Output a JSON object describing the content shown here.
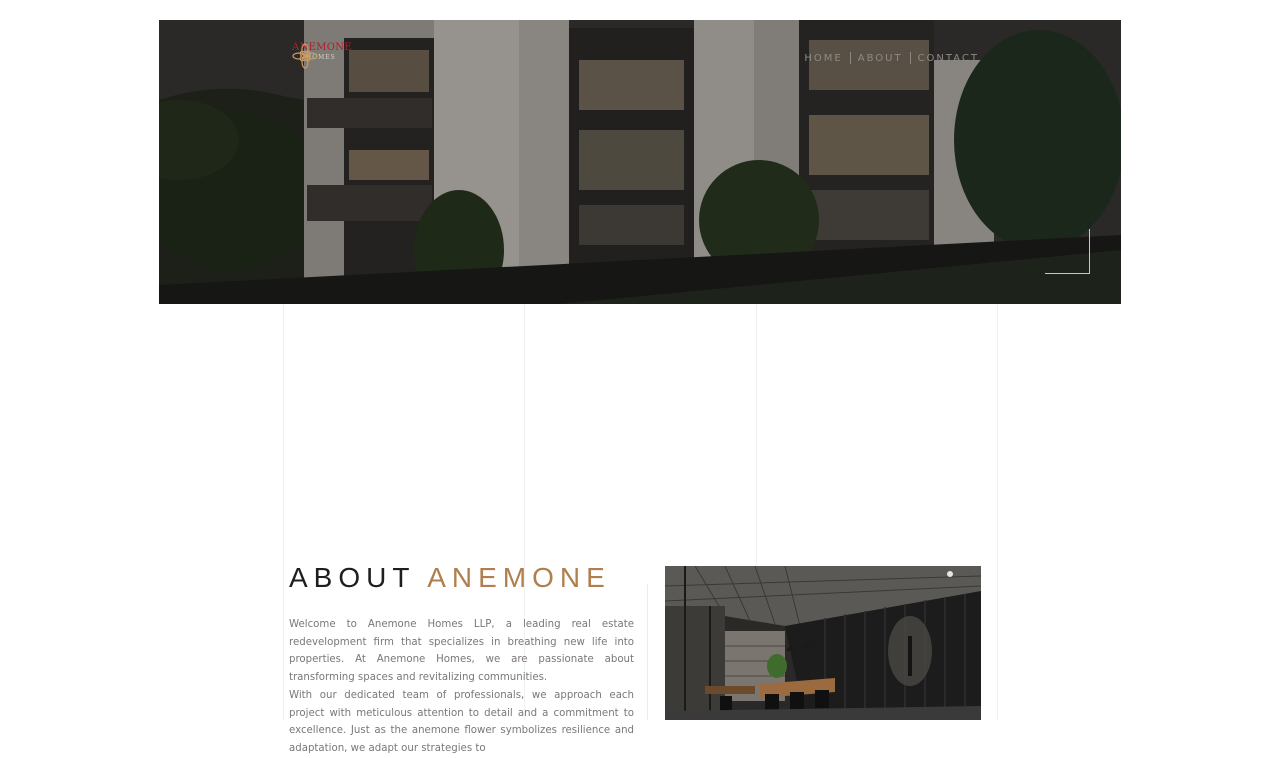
{
  "brand": {
    "name": "ANEMONE",
    "subtitle": "HOMES",
    "logo_icon": "anemone-flower-icon",
    "accent_color": "#b07f4e",
    "logo_color": "#b01f2a"
  },
  "nav": {
    "items": [
      {
        "label": "HOME"
      },
      {
        "label": "ABOUT"
      },
      {
        "label": "CONTACT"
      }
    ]
  },
  "about": {
    "title_plain": "ABOUT",
    "title_accent": "ANEMONE",
    "paragraphs": [
      "Welcome to Anemone Homes LLP, a leading real estate redevelopment firm that specializes in breathing new life into properties. At Anemone Homes, we are passionate about transforming spaces and revitalizing communities.",
      "With our dedicated team of professionals, we approach each project with meticulous attention to detail and a commitment to excellence. Just as the anemone flower symbolizes resilience and adaptation, we adapt our strategies to"
    ]
  }
}
